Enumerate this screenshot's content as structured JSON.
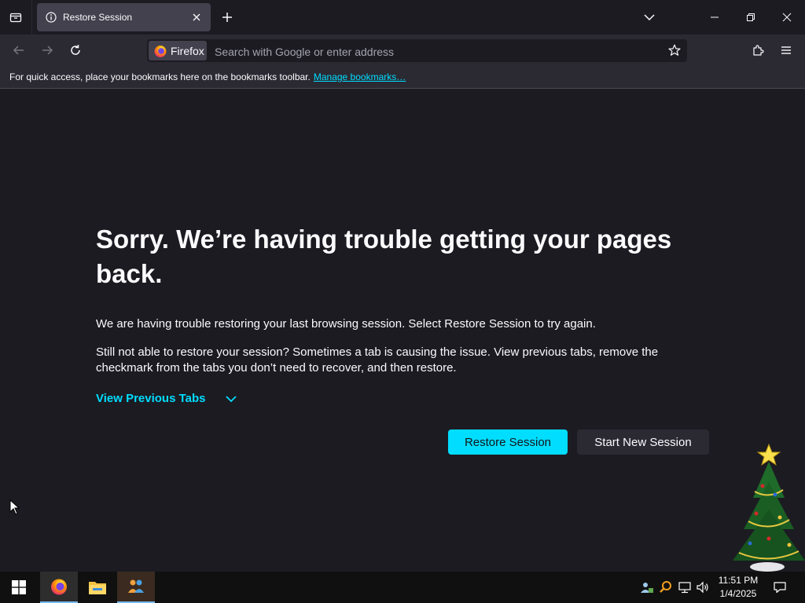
{
  "browser": {
    "tab": {
      "title": "Restore Session"
    },
    "identity_label": "Firefox",
    "url_placeholder": "Search with Google or enter address"
  },
  "bookmarks_bar": {
    "message": "For quick access, place your bookmarks here on the bookmarks toolbar.",
    "link": "Manage bookmarks…"
  },
  "page": {
    "title": "Sorry. We’re having trouble getting your pages back.",
    "paragraph1": "We are having trouble restoring your last browsing session. Select Restore Session to try again.",
    "paragraph2": "Still not able to restore your session? Sometimes a tab is causing the issue. View previous tabs, remove the checkmark from the tabs you don’t need to recover, and then restore.",
    "view_previous": "View Previous Tabs",
    "restore_button": "Restore Session",
    "new_session_button": "Start New Session"
  },
  "taskbar": {
    "time": "11:51 PM",
    "date": "1/4/2025",
    "apps": [
      "firefox-icon",
      "file-explorer-icon",
      "people-app-icon"
    ]
  },
  "colors": {
    "accent": "#00ddff",
    "background": "#1c1b22",
    "toolbar": "#2b2a33"
  }
}
